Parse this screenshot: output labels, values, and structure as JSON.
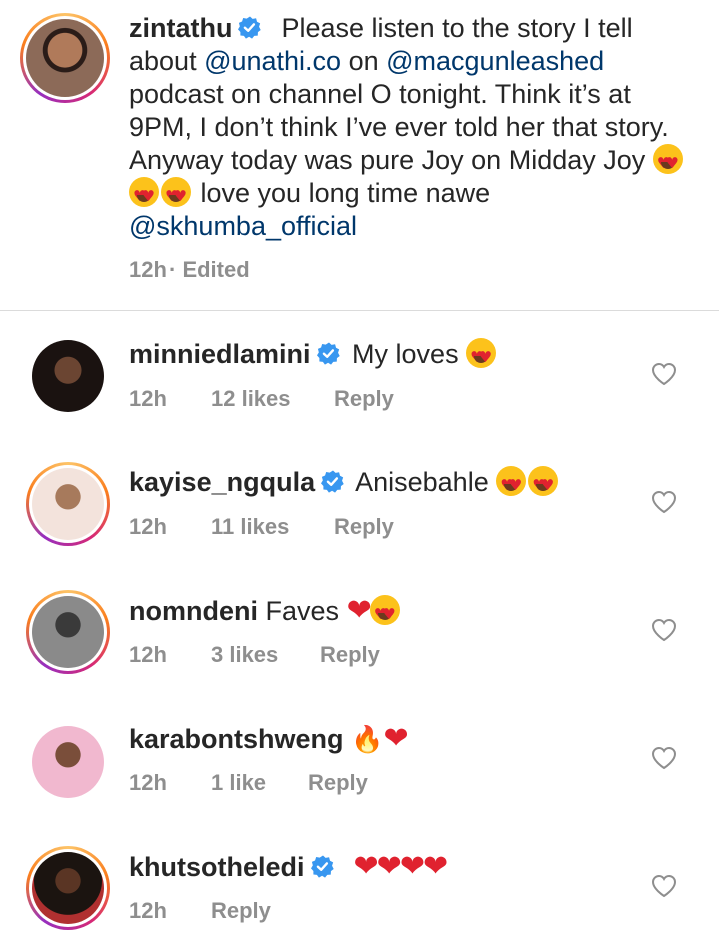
{
  "post": {
    "username": "zintathu",
    "caption_parts": {
      "text1": "Please listen to the story I tell about ",
      "mention1": "@unathi.co",
      "text2": " on ",
      "mention2": "@macgunleashed",
      "text3": " podcast on channel O tonight. Think it’s at 9PM, I don’t think I’ve ever told her that story. Anyway today was pure Joy on Midday Joy ",
      "text4": " love you long time nawe ",
      "mention3": "@skhumba_official"
    },
    "time": "12h",
    "edited": "· Edited"
  },
  "comments": [
    {
      "username": "minniedlamini",
      "text": "My loves",
      "time": "12h",
      "likes": "12 likes",
      "reply": "Reply"
    },
    {
      "username": "kayise_ngqula",
      "text": "Anisebahle",
      "time": "12h",
      "likes": "11 likes",
      "reply": "Reply"
    },
    {
      "username": "nomndeni",
      "text": "Faves",
      "time": "12h",
      "likes": "3 likes",
      "reply": "Reply"
    },
    {
      "username": "karabontshweng",
      "text": "",
      "time": "12h",
      "likes": "1 like",
      "reply": "Reply"
    },
    {
      "username": "khutsotheledi",
      "text": "",
      "time": "12h",
      "likes": "",
      "reply": "Reply"
    }
  ],
  "colors": {
    "mention": "#00376b",
    "verified": "#3897f0",
    "meta": "#8e8e8e",
    "heart": "#e0222f"
  },
  "icons": {
    "verified": "verified-badge-icon",
    "like": "heart-outline-icon",
    "heart_eyes": "heart-eyes-emoji",
    "red_heart": "red-heart-emoji",
    "fire": "fire-emoji"
  }
}
